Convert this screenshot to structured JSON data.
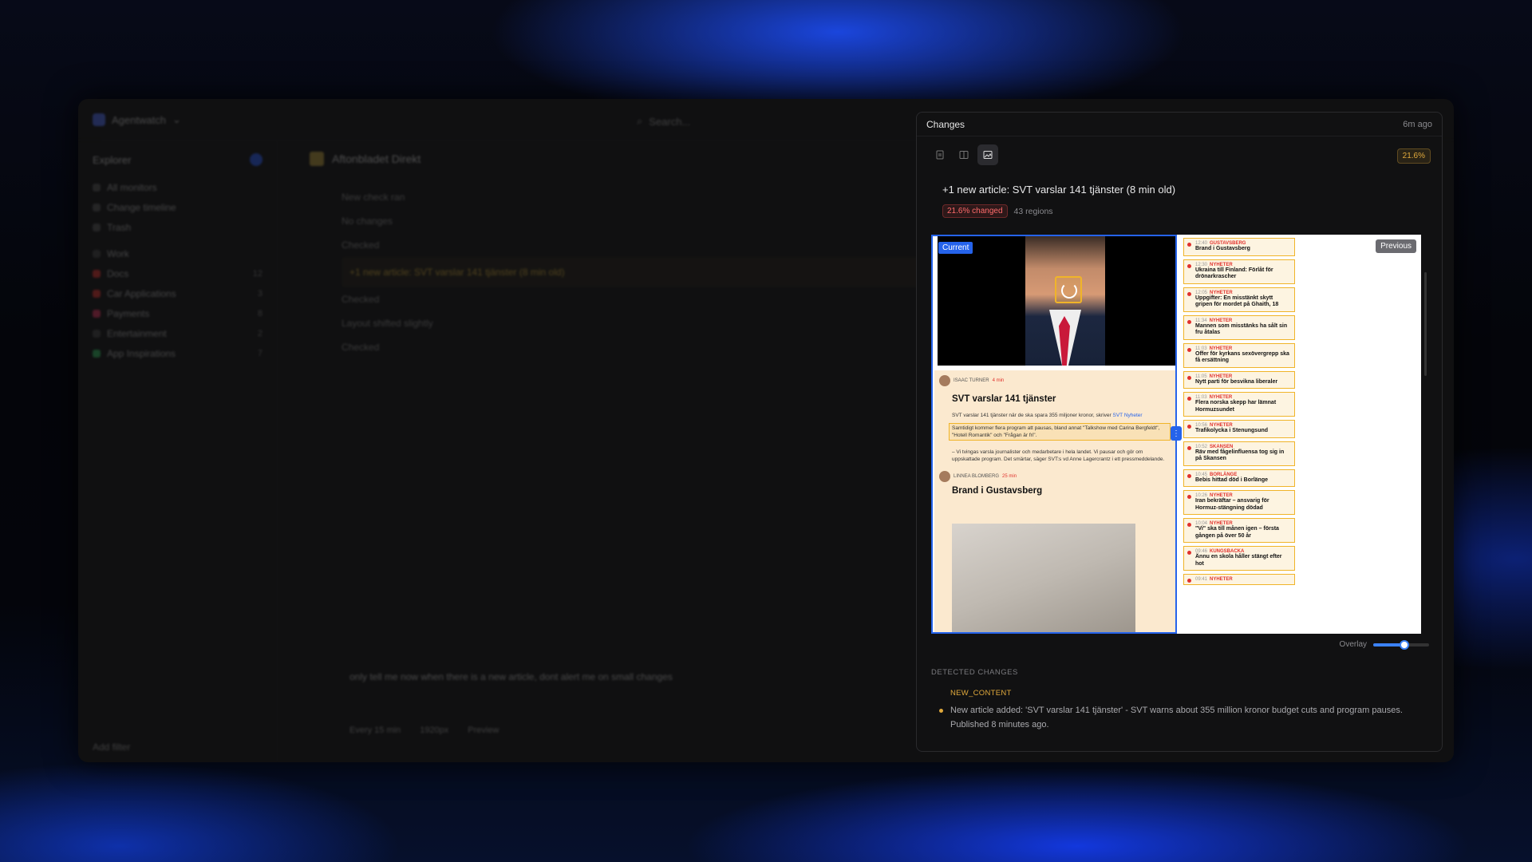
{
  "app": {
    "workspace": "Agentwatch",
    "search_placeholder": "Search..."
  },
  "sidebar": {
    "title": "Explorer",
    "items": [
      {
        "label": "All monitors"
      },
      {
        "label": "Change timeline"
      },
      {
        "label": "Trash"
      },
      {
        "label": "Work"
      },
      {
        "label": "Docs",
        "count": "12"
      },
      {
        "label": "Car Applications",
        "count": "3"
      },
      {
        "label": "Payments",
        "count": "8"
      },
      {
        "label": "Entertainment",
        "count": "2"
      },
      {
        "label": "App Inspirations",
        "count": "7"
      }
    ],
    "footer": "Add filter"
  },
  "main": {
    "title": "Aftonbladet Direkt",
    "feed": [
      "New check ran",
      "No changes",
      "Checked",
      "+1 new article: SVT varslar 141 tjänster (8 min old)",
      "Checked",
      "Layout shifted slightly",
      "Checked"
    ],
    "chat": "only tell me now when there is a new article, dont alert me on small changes",
    "composer": [
      "Every 15 min",
      "1920px",
      "Preview"
    ]
  },
  "panel": {
    "title": "Changes",
    "time": "6m ago",
    "pct": "21.6%",
    "headline": "+1 new article: SVT varslar 141 tjänster (8 min old)",
    "changed_badge": "21.6% changed",
    "regions": "43 regions",
    "current_label": "Current",
    "previous_label": "Previous",
    "overlay_label": "Overlay",
    "overlay_value": 0.55,
    "detected_heading": "DETECTED CHANGES",
    "change_type": "NEW_CONTENT",
    "change_text": "New article added: 'SVT varslar 141 tjänster' - SVT warns about 355 million kronor budget cuts and program pauses. Published 8 minutes ago."
  },
  "current": {
    "article1": {
      "author": "ISAAC TURNER",
      "age": "4 min",
      "title": "SVT varslar 141 tjänster",
      "p1": "SVT varslar 141 tjänster när de ska spara 355 miljoner kronor, skriver",
      "p1_link": "SVT Nyheter",
      "p2": "Samtidigt kommer flera program att pausas, bland annat \"Talkshow med Carina Bergfeldt\", \"Hotell Romantik\" och \"Frågan är fri\".",
      "p3": "– Vi tvingas varsla journalister och medarbetare i hela landet. Vi pausar och gör om uppskattade program. Det smärtar, säger SVT:s vd Anne Lagercrantz i ett pressmeddelande."
    },
    "article2": {
      "author": "LINNEA BLOMBERG",
      "age": "25 min",
      "title": "Brand i Gustavsberg"
    }
  },
  "previous": {
    "items": [
      {
        "time": "12:40",
        "tag": "GUSTAVSBERG",
        "title": "Brand i Gustavsberg"
      },
      {
        "time": "12:30",
        "tag": "NYHETER",
        "title": "Ukraina till Finland: Förlåt för drönarkrascher"
      },
      {
        "time": "12:05",
        "tag": "NYHETER",
        "title": "Uppgifter: En misstänkt skytt gripen för mordet på Ghaith, 18"
      },
      {
        "time": "11:34",
        "tag": "NYHETER",
        "title": "Mannen som misstänks ha sålt sin fru åtalas"
      },
      {
        "time": "11:03",
        "tag": "NYHETER",
        "title": "Offer för kyrkans sexövergrepp ska få ersättning"
      },
      {
        "time": "11:05",
        "tag": "NYHETER",
        "title": "Nytt parti för besvikna liberaler"
      },
      {
        "time": "11:03",
        "tag": "NYHETER",
        "title": "Flera norska skepp har lämnat Hormuzsundet"
      },
      {
        "time": "10:56",
        "tag": "NYHETER",
        "title": "Trafikolycka i Stenungsund"
      },
      {
        "time": "10:52",
        "tag": "SKANSEN",
        "title": "Räv med fågelinfluensa tog sig in på Skansen"
      },
      {
        "time": "10:45",
        "tag": "BORLÄNGE",
        "title": "Bebis hittad död i Borlänge"
      },
      {
        "time": "10:26",
        "tag": "NYHETER",
        "title": "Iran bekräftar – ansvarig för Hormuz-stängning dödad"
      },
      {
        "time": "10:04",
        "tag": "NYHETER",
        "title": "\"Vi\" ska till månen igen – första gången på över 50 år"
      },
      {
        "time": "09:46",
        "tag": "KUNGSBACKA",
        "title": "Ännu en skola håller stängt efter hot"
      },
      {
        "time": "09:41",
        "tag": "NYHETER",
        "title": ""
      }
    ]
  }
}
